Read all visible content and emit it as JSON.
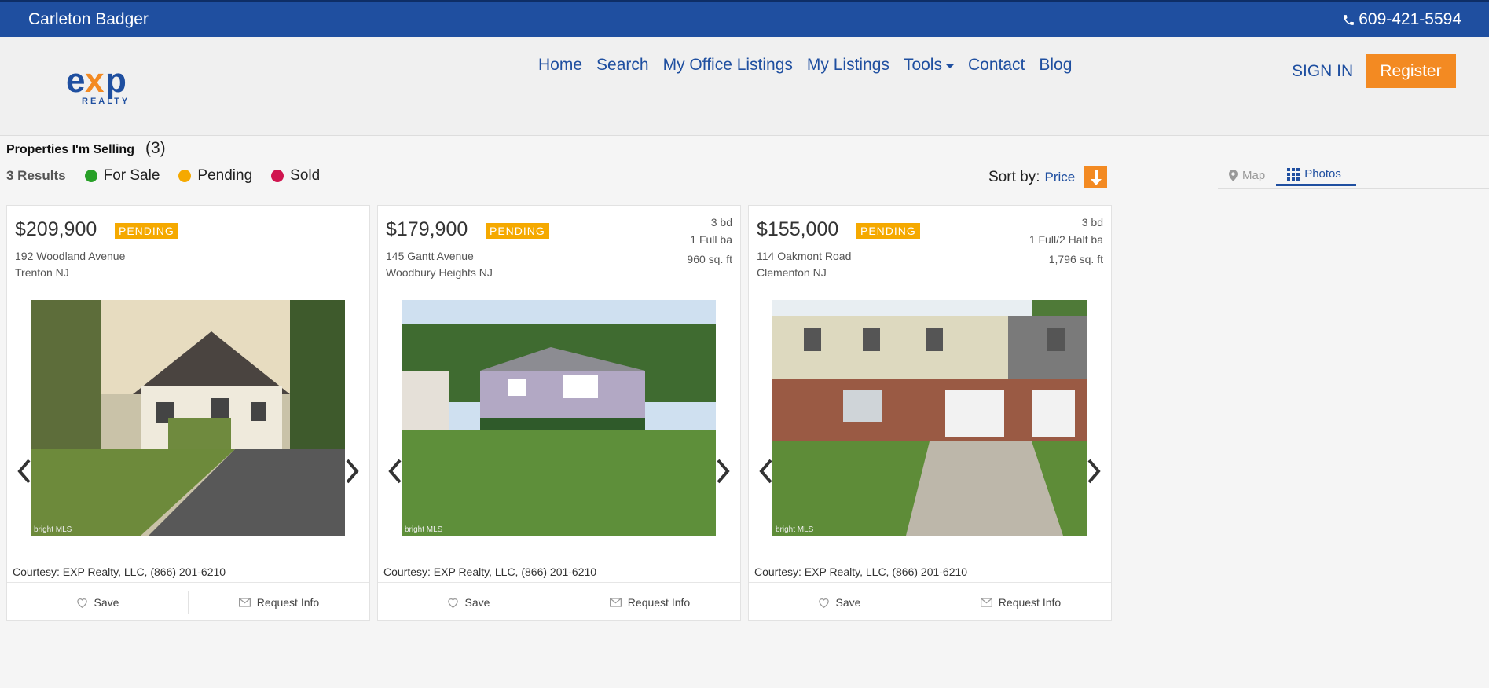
{
  "topbar": {
    "agent_name": "Carleton Badger",
    "phone": "609-421-5594"
  },
  "logo": {
    "brand": "eXp",
    "sub": "REALTY",
    "colors": {
      "blue": "#1f4fa0",
      "orange": "#f38a22"
    }
  },
  "nav": {
    "items": [
      "Home",
      "Search",
      "My Office Listings",
      "My Listings",
      "Tools",
      "Contact",
      "Blog"
    ]
  },
  "auth": {
    "sign_in": "SIGN IN",
    "register": "Register"
  },
  "listing_header": {
    "title": "Properties I'm Selling",
    "count": "(3)"
  },
  "filters": {
    "results": "3 Results",
    "legend": [
      {
        "label": "For Sale",
        "color": "#28a028"
      },
      {
        "label": "Pending",
        "color": "#f5a900"
      },
      {
        "label": "Sold",
        "color": "#d0154f"
      }
    ]
  },
  "sort": {
    "label": "Sort by:",
    "value": "Price",
    "direction_icon": "arrow-down-icon"
  },
  "view_toggle": {
    "map": "Map",
    "photos": "Photos",
    "active": "Photos"
  },
  "listings": [
    {
      "price": "$209,900",
      "status": "PENDING",
      "address_line1": "192 Woodland Avenue",
      "address_line2": "Trenton NJ",
      "beds": "",
      "baths": "",
      "sqft": "",
      "courtesy": "Courtesy: EXP Realty, LLC, (866) 201-6210",
      "save": "Save",
      "request": "Request Info"
    },
    {
      "price": "$179,900",
      "status": "PENDING",
      "address_line1": "145 Gantt Avenue",
      "address_line2": "Woodbury Heights NJ",
      "beds": "3 bd",
      "baths": "1 Full ba",
      "sqft": "960 sq. ft",
      "courtesy": "Courtesy: EXP Realty, LLC, (866) 201-6210",
      "save": "Save",
      "request": "Request Info"
    },
    {
      "price": "$155,000",
      "status": "PENDING",
      "address_line1": "114 Oakmont Road",
      "address_line2": "Clementon NJ",
      "beds": "3 bd",
      "baths": "1 Full/2 Half ba",
      "sqft": "1,796 sq. ft",
      "courtesy": "Courtesy: EXP Realty, LLC, (866) 201-6210",
      "save": "Save",
      "request": "Request Info"
    }
  ],
  "photo_watermark": "bright MLS"
}
